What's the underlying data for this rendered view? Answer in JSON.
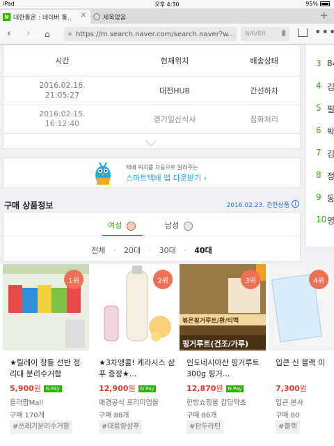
{
  "statusbar": {
    "device": "iPad",
    "time": "오후 4:30",
    "battery": "95%"
  },
  "tabs": [
    {
      "title": "대한통운 : 네이버 통..."
    },
    {
      "title": "제목없음"
    }
  ],
  "addressbar": {
    "url": "https://m.search.naver.com/search.naver?w...",
    "search_placeholder": "NAVER"
  },
  "delivery": {
    "headers": [
      "시간",
      "현재위치",
      "배송상태"
    ],
    "rows": [
      {
        "date": "2016.02.16.",
        "time": "21:05:27",
        "location": "대전HUB",
        "status": "간선하차"
      },
      {
        "date": "2016.02.15.",
        "time": "16:12:40",
        "location": "경기일산식사",
        "status": "집화처리"
      }
    ]
  },
  "banner": {
    "small": "택배 위치를 자동으로 알려주는",
    "big": "스마트택배 앱 다운받기 ›"
  },
  "purchase": {
    "title": "구매 상품정보",
    "date_label": "2016.02.23. 관련상품",
    "info": "i",
    "female": "여성",
    "male": "남성",
    "ages": [
      "전체",
      "20대",
      "30대",
      "40대"
    ],
    "dot": "·"
  },
  "products": [
    {
      "rank": "1위",
      "name": "★릴레이 창틀 선반 정리대 분리수거함",
      "price": "5,900",
      "won": "원",
      "npay": "N Pay",
      "seller": "플라팜Mall",
      "count": "구매 170개",
      "tag": "#쓰레기분리수거함"
    },
    {
      "rank": "2위",
      "name": "★3차앵콜! 케라시스 샴푸 증정★...",
      "price": "12,900",
      "won": "원",
      "npay": "N Pay",
      "seller": "애경공식 프리미엄몰",
      "count": "구매 88개",
      "tag": "#대용량샴푸"
    },
    {
      "rank": "3위",
      "name": "인도네시아산 핑거루트 300g 핑거...",
      "price": "12,870",
      "won": "원",
      "npay": "N Pay",
      "seller": "한방쇼핑몰 갑당약초",
      "count": "구매 86개",
      "tag": "#판두라틴",
      "img_text1": "볶은핑거루트/환/티백",
      "img_text2": "핑거루트(건조/가루)"
    },
    {
      "rank": "4위",
      "name": "입큰 신 블랙 미",
      "price": "7,300",
      "won": "원",
      "npay": "",
      "seller": "입큰 본사",
      "count": "구매 80",
      "tag": "#블랙"
    }
  ],
  "side": [
    {
      "n": "3",
      "w": "84"
    },
    {
      "n": "4",
      "w": "김"
    },
    {
      "n": "5",
      "w": "필"
    },
    {
      "n": "6",
      "w": "박"
    },
    {
      "n": "7",
      "w": "김"
    },
    {
      "n": "8",
      "w": "정"
    },
    {
      "n": "9",
      "w": "동"
    },
    {
      "n": "10",
      "w": "영"
    }
  ],
  "colors": {
    "naver_green": "#2db400",
    "rank_badge": "#f26f56",
    "price": "#e23b2a",
    "link_blue": "#2f72c4"
  }
}
